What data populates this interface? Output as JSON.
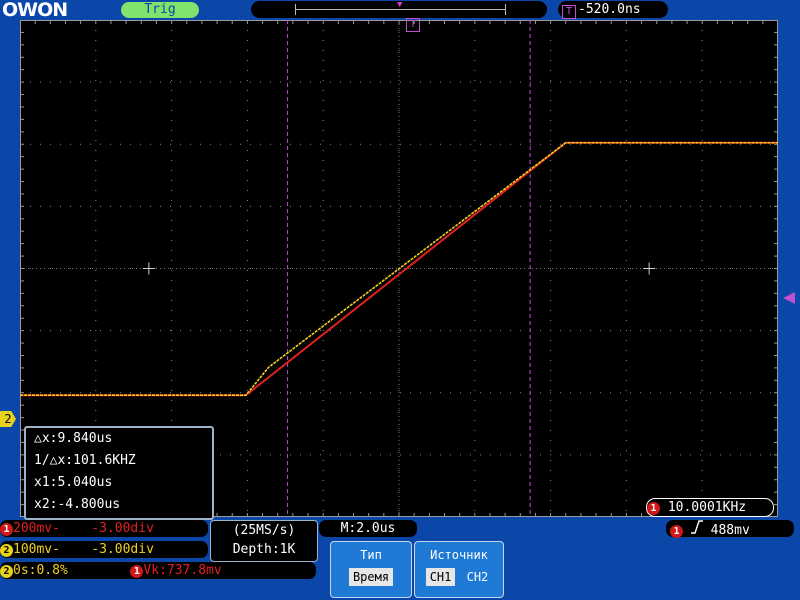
{
  "header": {
    "logo": "OWON",
    "trigger_status": "Trig",
    "trigger_offset": "-520.0ns",
    "trigger_marker": "T"
  },
  "screen": {
    "channel2_marker": "2",
    "colors": {
      "ch1": "#e02020",
      "ch2": "#f0d020",
      "cursor": "#c04fd0",
      "grid": "#8a8a8a"
    }
  },
  "cursor_panel": {
    "delta_x": "△x:9.840us",
    "inv_delta_x": "1/△x:101.6KHZ",
    "x1": "x1:5.040us",
    "x2": "x2:-4.800us"
  },
  "frequency": {
    "channel": "1",
    "value": "10.0001KHz"
  },
  "status": {
    "ch1": {
      "num": "1",
      "volts": "200mv-",
      "offset": "-3.00div"
    },
    "ch2": {
      "num": "2",
      "volts": "100mv-",
      "offset": "-3.00div"
    },
    "math": {
      "num": "2",
      "text": "0s:0.8%",
      "ch": "1",
      "vk": "Vk:737.8mv"
    },
    "sample_rate": "(25MS/s)",
    "depth": "Depth:1K",
    "timebase": "M:2.0us",
    "trigger": {
      "ch": "1",
      "level": "488mv"
    }
  },
  "menu": {
    "type_title": "Тип",
    "type_value": "Время",
    "source_title": "Источник",
    "source_options": [
      "CH1",
      "CH2"
    ]
  }
}
